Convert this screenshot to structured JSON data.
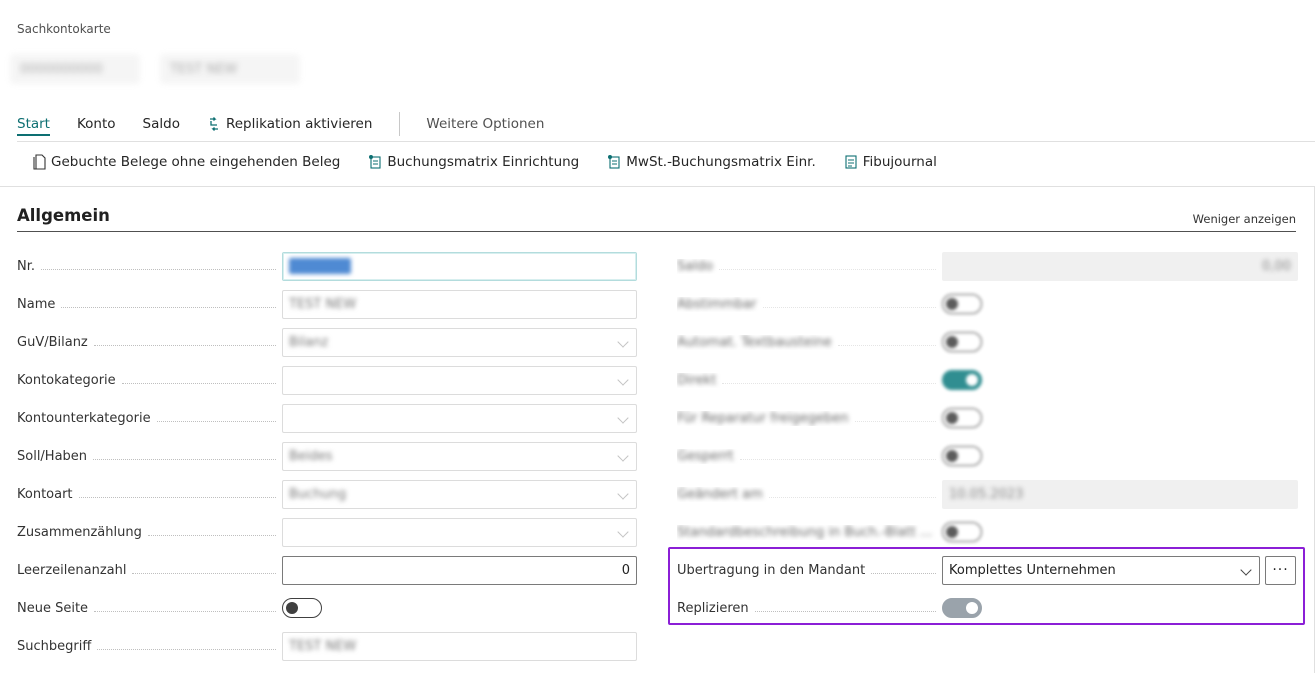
{
  "page": {
    "caption": "Sachkontokarte",
    "title_parts": [
      "0000000000",
      "TEST NEW"
    ]
  },
  "actions": {
    "start": "Start",
    "konto": "Konto",
    "saldo": "Saldo",
    "replikation": "Replikation aktivieren",
    "more": "Weitere Optionen"
  },
  "subactions": {
    "belege": "Gebuchte Belege ohne eingehenden Beleg",
    "buchungsmatrix": "Buchungsmatrix Einrichtung",
    "mwst": "MwSt.-Buchungsmatrix Einr.",
    "fibu": "Fibujournal"
  },
  "section": {
    "title": "Allgemein",
    "toggle_link": "Weniger anzeigen"
  },
  "left": {
    "nr": {
      "label": "Nr.",
      "value": "0000000"
    },
    "name": {
      "label": "Name",
      "value": "TEST NEW"
    },
    "guv": {
      "label": "GuV/Bilanz",
      "value": "Bilanz"
    },
    "kategorie": {
      "label": "Kontokategorie",
      "value": ""
    },
    "unterkategorie": {
      "label": "Kontounterkategorie",
      "value": ""
    },
    "sollhaben": {
      "label": "Soll/Haben",
      "value": "Beides"
    },
    "kontoart": {
      "label": "Kontoart",
      "value": "Buchung"
    },
    "zusammen": {
      "label": "Zusammenzählung",
      "value": ""
    },
    "leerzeilen": {
      "label": "Leerzeilenanzahl",
      "value": "0"
    },
    "neueseite": {
      "label": "Neue Seite",
      "value": false
    },
    "such": {
      "label": "Suchbegriff",
      "value": "TEST NEW"
    }
  },
  "right": {
    "saldo": {
      "label": "Saldo",
      "value": "0,00"
    },
    "abstimmbar": {
      "label": "Abstimmbar"
    },
    "autoteil": {
      "label": "Automat. Textbausteine"
    },
    "direkt": {
      "label": "Direkt"
    },
    "reparatur": {
      "label": "Für Reparatur freigegeben"
    },
    "gesperrt": {
      "label": "Gesperrt"
    },
    "geaendert": {
      "label": "Geändert am",
      "value": "10.05.2023"
    },
    "standard": {
      "label": "Standardbeschreibung in Buch.-Blatt ..."
    },
    "uebertragung": {
      "label": "Übertragung in den Mandant",
      "value": "Komplettes Unternehmen",
      "more": "···"
    },
    "replizieren": {
      "label": "Replizieren",
      "value": true
    }
  },
  "colors": {
    "accent": "#0d7b7e",
    "highlight": "#8b1fd6"
  }
}
